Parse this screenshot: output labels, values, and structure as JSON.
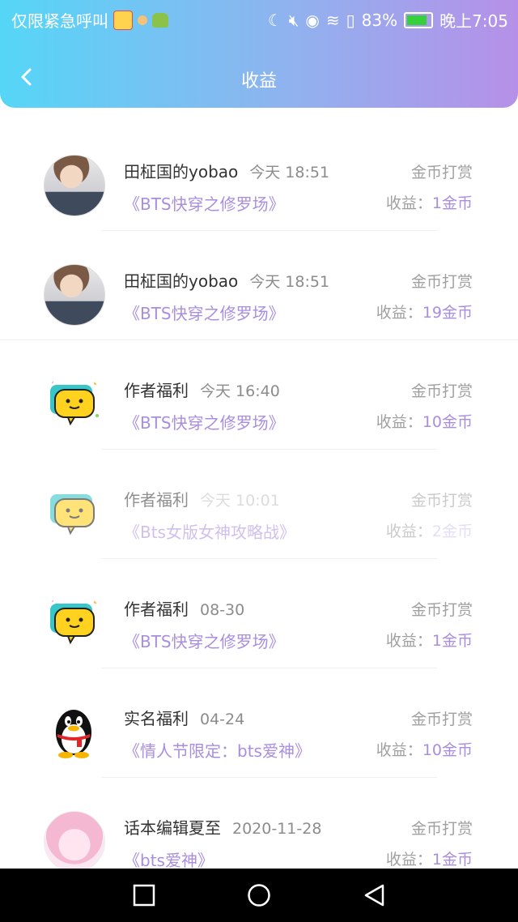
{
  "status_bar": {
    "left_text": "仅限紧急呼叫",
    "battery": "83%",
    "time": "晚上7:05"
  },
  "header": {
    "title": "收益"
  },
  "records": [
    {
      "name": "田柾国的yobao",
      "time": "今天 18:51",
      "tag": "金币打赏",
      "book": "《BTS快穿之修罗场》",
      "earn_label": "收益：",
      "earn_amount": "1金币",
      "avatar": "person-photo"
    },
    {
      "name": "田柾国的yobao",
      "time": "今天 18:51",
      "tag": "金币打赏",
      "book": "《BTS快穿之修罗场》",
      "earn_label": "收益：",
      "earn_amount": "19金币",
      "avatar": "person-photo"
    },
    {
      "name": "作者福利",
      "time": "今天 16:40",
      "tag": "金币打赏",
      "book": "《BTS快穿之修罗场》",
      "earn_label": "收益：",
      "earn_amount": "10金币",
      "avatar": "chat-bubble"
    },
    {
      "name": "作者福利",
      "time": "今天 10:01",
      "tag": "金币打赏",
      "book": "《Bts女版女神攻略战》",
      "earn_label": "收益：",
      "earn_amount": "2金币",
      "avatar": "chat-bubble"
    },
    {
      "name": "作者福利",
      "time": "08-30",
      "tag": "金币打赏",
      "book": "《BTS快穿之修罗场》",
      "earn_label": "收益：",
      "earn_amount": "1金币",
      "avatar": "chat-bubble"
    },
    {
      "name": "实名福利",
      "time": "04-24",
      "tag": "金币打赏",
      "book": "《情人节限定：bts爱神》",
      "earn_label": "收益：",
      "earn_amount": "10金币",
      "avatar": "qq-penguin"
    },
    {
      "name": "话本编辑夏至",
      "time": "2020-11-28",
      "tag": "金币打赏",
      "book": "《bts爱神》",
      "earn_label": "收益：",
      "earn_amount": "1金币",
      "avatar": "anime-girl"
    }
  ],
  "colors": {
    "accent": "#a98ee0",
    "header_start": "#55d6f7",
    "header_end": "#b690e8"
  }
}
